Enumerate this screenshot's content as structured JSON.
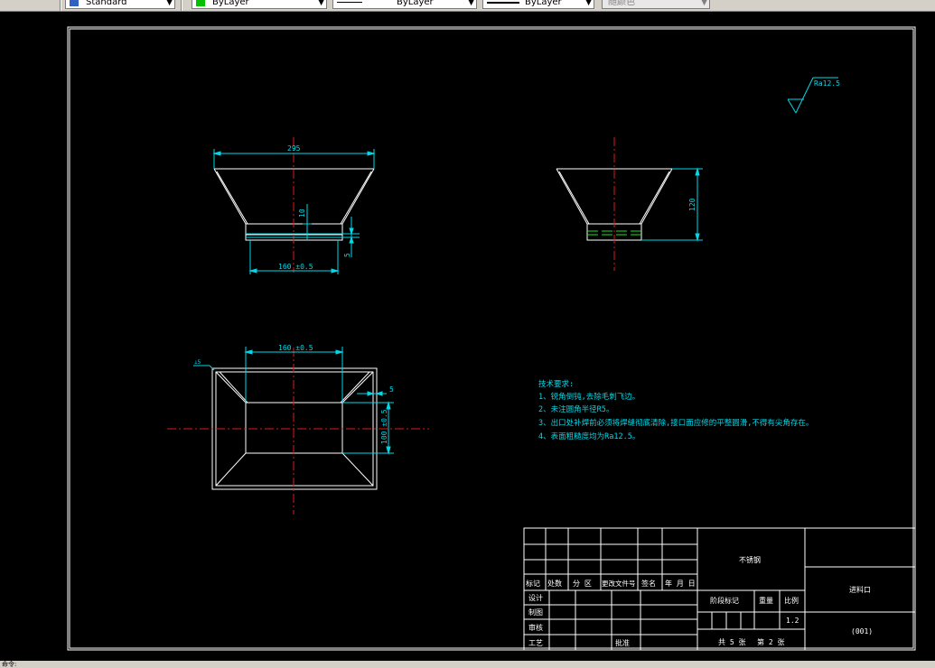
{
  "toolbar": {
    "text_style": "Standard",
    "layer_color": "ByLayer",
    "linetype": "ByLayer",
    "lineweight": "ByLayer",
    "plot_style": "随颜色",
    "layer_color_swatch": "#00c000"
  },
  "colors": {
    "outline": "#ffffff",
    "dimension": "#00d8e8",
    "centerline": "#e01818",
    "hidden": "#20e020",
    "canvas": "#000000"
  },
  "drawing": {
    "front_view": {
      "dim_top": "295",
      "dim_height": "10",
      "dim_bottom": "160 ±0.5",
      "dim_offset": "5"
    },
    "side_view": {
      "dim_height": "120"
    },
    "top_view": {
      "dim_width": "160 ±0.5",
      "dim_gap": "5",
      "dim_depth": "100 ±0.5",
      "section_mark": "⊥5"
    },
    "roughness": "Ra12.5",
    "tech_requirements": {
      "title": "技术要求:",
      "items": [
        "1、锐角倒钝,去除毛刺飞边。",
        "2、未注圆角半径R5。",
        "3、出口处补焊前必须将焊缝彻底清除,接口面应修的平整圆滑,不得有尖角存在。",
        "4、表面粗糙度均为Ra12.5。"
      ]
    }
  },
  "title_block": {
    "material": "不锈钢",
    "part_name": "进料口",
    "drawing_number": "(001)",
    "header": [
      "标记",
      "处数",
      "分 区",
      "更改文件号",
      "签名",
      "年 月 日"
    ],
    "roles": [
      "设计",
      "制图",
      "审核",
      "工艺"
    ],
    "approve": "批准",
    "stage_mark": "阶段标记",
    "weight": "重量",
    "scale_label": "比例",
    "scale_value": "1.2",
    "sheets_total": "共 5 张",
    "sheet_no": "第 2 张"
  },
  "status": {
    "prompt": "命令:"
  }
}
